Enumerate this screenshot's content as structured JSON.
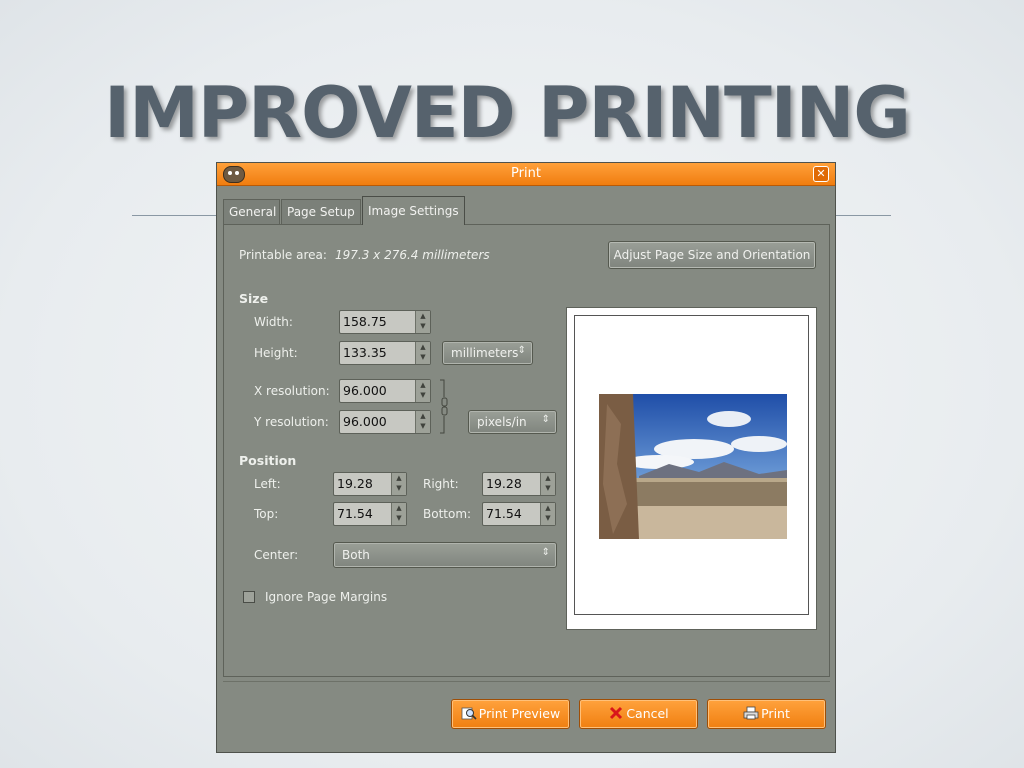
{
  "slide": {
    "title": "IMPROVED PRINTING"
  },
  "dialog": {
    "title": "Print",
    "close_icon": "close-icon",
    "tabs": [
      {
        "label": "General",
        "active": false
      },
      {
        "label": "Page Setup",
        "active": false
      },
      {
        "label": "Image Settings",
        "active": true
      }
    ],
    "printable_area_label": "Printable area:",
    "printable_area_value": "197.3 x 276.4 millimeters",
    "adjust_button": "Adjust Page Size and Orientation",
    "size": {
      "heading": "Size",
      "width_label": "Width:",
      "width_value": "158.75",
      "height_label": "Height:",
      "height_value": "133.35",
      "units": "millimeters",
      "xres_label": "X resolution:",
      "xres_value": "96.000",
      "yres_label": "Y resolution:",
      "yres_value": "96.000",
      "res_units": "pixels/in"
    },
    "position": {
      "heading": "Position",
      "left_label": "Left:",
      "left_value": "19.28",
      "right_label": "Right:",
      "right_value": "19.28",
      "top_label": "Top:",
      "top_value": "71.54",
      "bottom_label": "Bottom:",
      "bottom_value": "71.54",
      "center_label": "Center:",
      "center_value": "Both"
    },
    "ignore_margins_label": "Ignore Page Margins",
    "ignore_margins_checked": false,
    "buttons": {
      "preview": "Print Preview",
      "cancel": "Cancel",
      "print": "Print"
    }
  },
  "colors": {
    "dialog_bg": "#858a82",
    "accent_orange": "#f58b1f",
    "title_text": "#56626d"
  }
}
